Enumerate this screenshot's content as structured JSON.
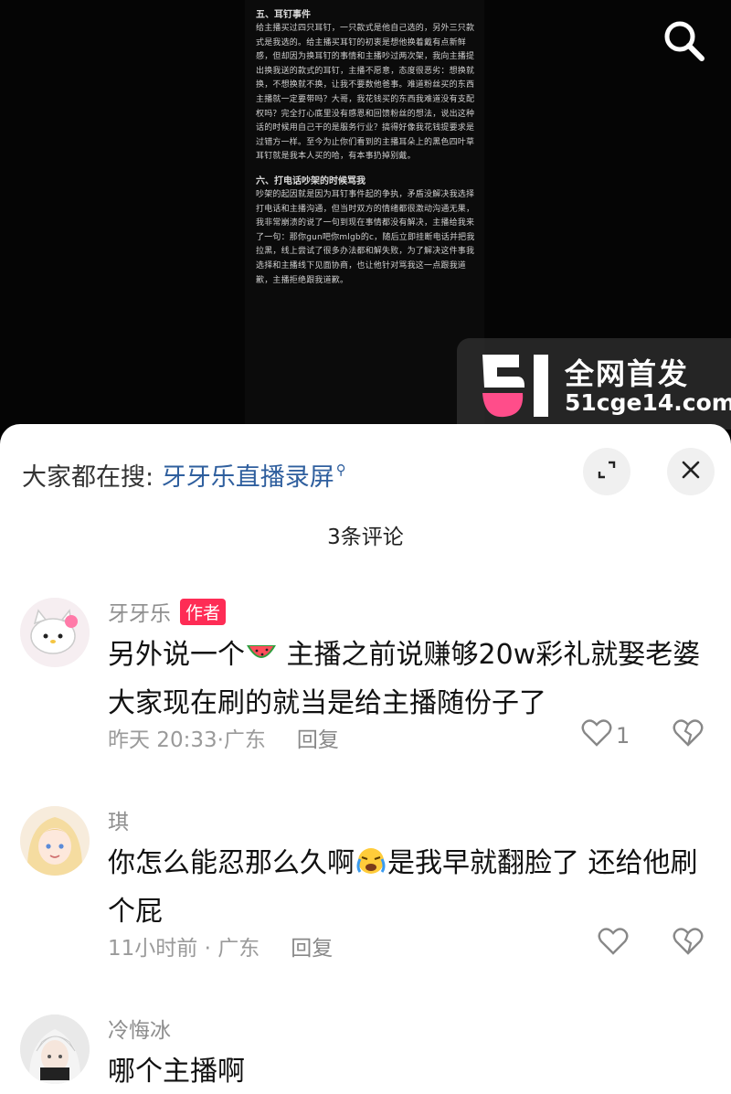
{
  "video": {
    "doc_title_5": "五、耳钉事件",
    "doc_body_5": "给主播买过四只耳钉，一只款式是他自己选的，另外三只款式是我选的。给主播买耳钉的初衷是想他换着戴有点新鲜感，但却因为换耳钉的事情和主播吵过两次架，我向主播提出换我送的款式的耳钉，主播不愿意，态度很恶劣：想换就换，不想换就不换，让我不要数他爸事。难道粉丝买的东西主播就一定要带吗？大哥，我花钱买的东西我难道没有支配权吗？完全打心底里没有感恩和回馈粉丝的想法，说出这种话的时候用自己干的是服务行业？搞得好像我花钱提要求是过错方一样。至今为止你们看到的主播耳朵上的黑色四叶草耳钉就是我本人买的哈，有本事扔掉别戴。",
    "doc_title_6": "六、打电话吵架的时候骂我",
    "doc_body_6": "吵架的起因就是因为耳钉事件起的争执，矛盾没解决我选择打电话和主播沟通，但当时双方的情绪都很激动沟通无果，我非常崩溃的说了一句到现在事情都没有解决，主播给我来了一句：那你gun吧你mlgb的c，随后立即挂断电话并把我拉黑，线上尝试了很多办法都和解失败，为了解决这件事我选择和主播线下见面协商，也让他针对骂我这一点跟我道歉，主播拒绝跟我道歉。",
    "search_icon": "search-icon"
  },
  "watermark": {
    "title": "全网首发",
    "url": "51cge14.com",
    "logo": "51-logo"
  },
  "sheet": {
    "hot_label": "大家都在搜:",
    "hot_keyword": "牙牙乐直播录屏",
    "comment_count": "3条评论",
    "expand_icon": "expand-icon",
    "close_icon": "close-icon"
  },
  "comments": [
    {
      "user": "牙牙乐",
      "badge": "作者",
      "text_a": "另外说一个",
      "text_b": " 主播之前说赚够20w彩礼就娶老婆 大家现在刷的就当是给主播随份子了",
      "emoji": "watermelon-emoji",
      "time": "昨天 20:33·广东",
      "reply": "回复",
      "likes": "1"
    },
    {
      "user": "琪",
      "text_a": "你怎么能忍那么久啊",
      "text_b": "是我早就翻脸了 还给他刷个屁",
      "emoji": "crying-face-emoji",
      "time": "11小时前 · 广东",
      "reply": "回复"
    },
    {
      "user": "冷悔冰",
      "text_a": "哪个主播啊"
    }
  ]
}
